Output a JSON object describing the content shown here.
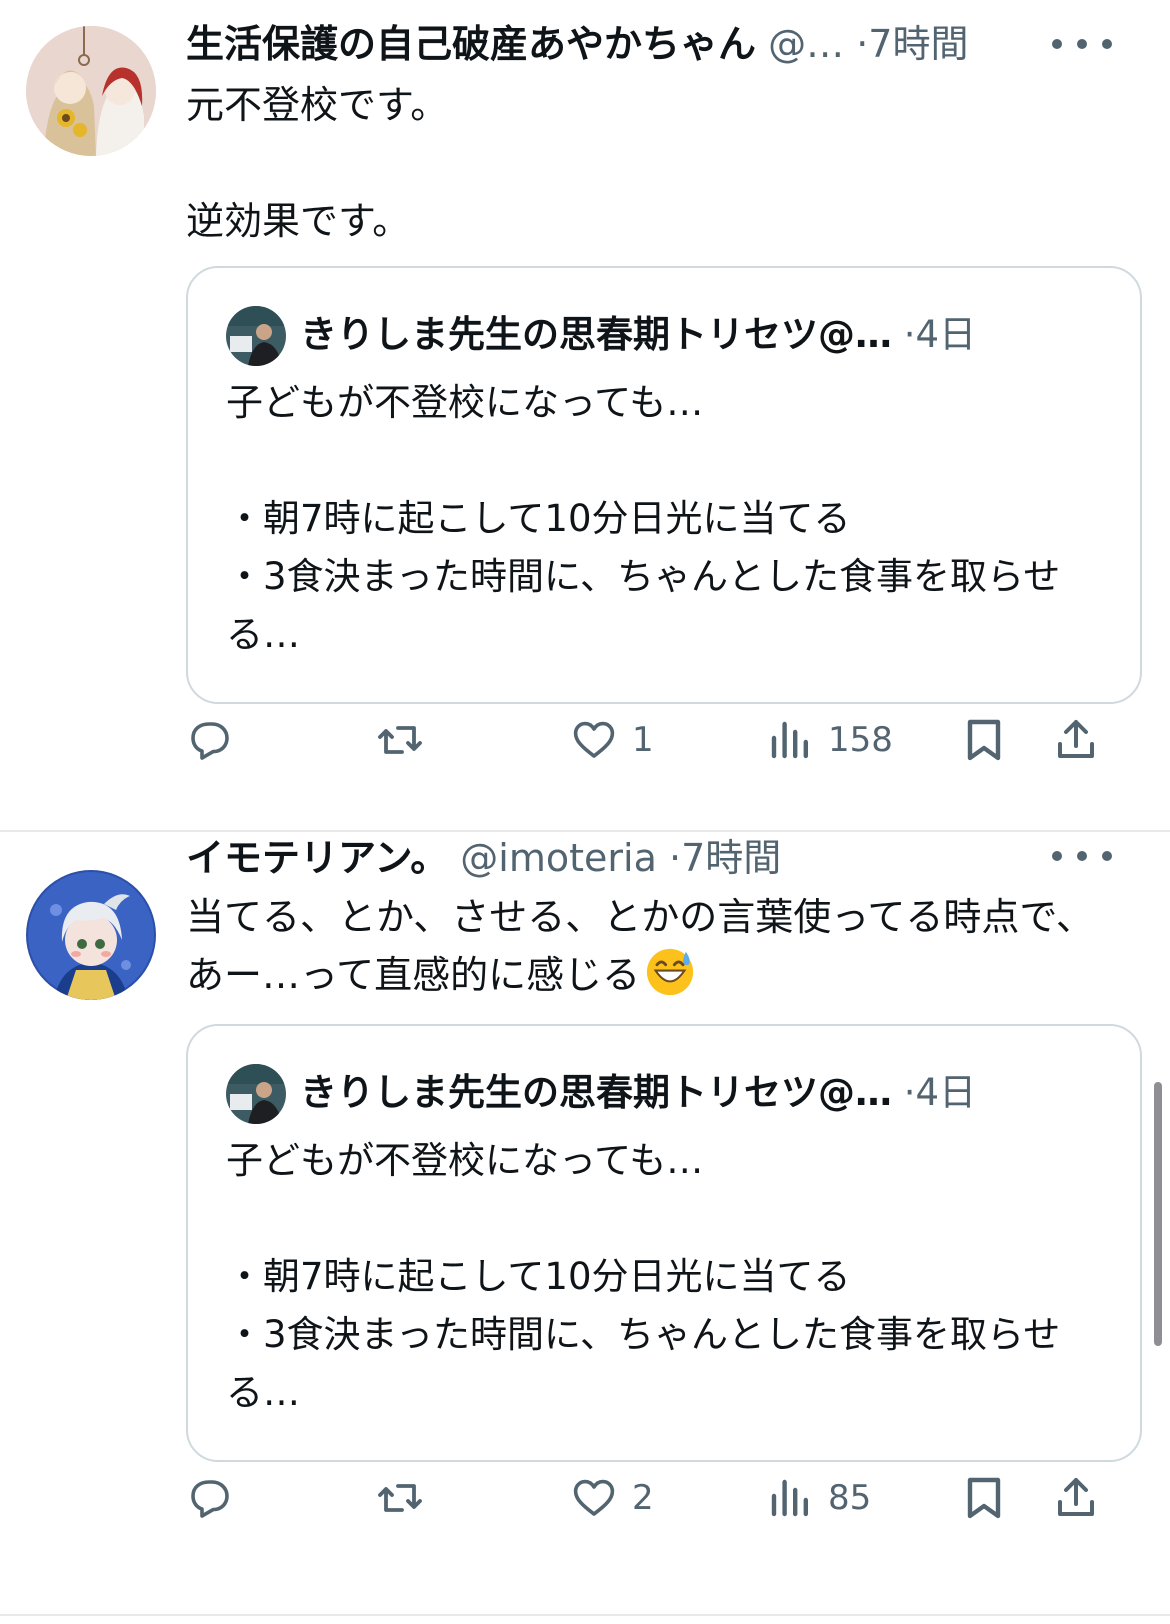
{
  "tweets": [
    {
      "name": "生活保護の自己破産あやかちゃん",
      "handle": "@…",
      "dot": "·",
      "time": "7時間",
      "body": "元不登校です。\n\n逆効果です。",
      "quote": {
        "name": "きりしま先生の思春期トリセツ@…",
        "dot": "·",
        "time": "4日",
        "body": "子どもが不登校になっても…\n\n・朝7時に起こして10分日光に当てる\n・3食決まった時間に、ちゃんとした食事を取らせる…"
      },
      "actions": {
        "likes": "1",
        "views": "158"
      }
    },
    {
      "name": "イモテリアン。",
      "handle": "@imoteria",
      "dot": "·",
      "time": "7時間",
      "body": "当てる、とか、させる、とかの言葉使ってる時点で、あー…って直感的に感じる",
      "emoji": "grinning-sweat-emoji",
      "quote": {
        "name": "きりしま先生の思春期トリセツ@…",
        "dot": "·",
        "time": "4日",
        "body": "子どもが不登校になっても…\n\n・朝7時に起こして10分日光に当てる\n・3食決まった時間に、ちゃんとした食事を取らせる…"
      },
      "actions": {
        "likes": "2",
        "views": "85"
      }
    }
  ],
  "icons": {
    "reply": "reply-icon",
    "retweet": "retweet-icon",
    "like": "heart-icon",
    "views": "views-icon",
    "bookmark": "bookmark-icon",
    "share": "share-icon",
    "more": "more-icon"
  },
  "colors": {
    "text": "#0f1419",
    "secondary": "#536471",
    "border": "#cfd9de",
    "divider": "#e7e9ea"
  }
}
